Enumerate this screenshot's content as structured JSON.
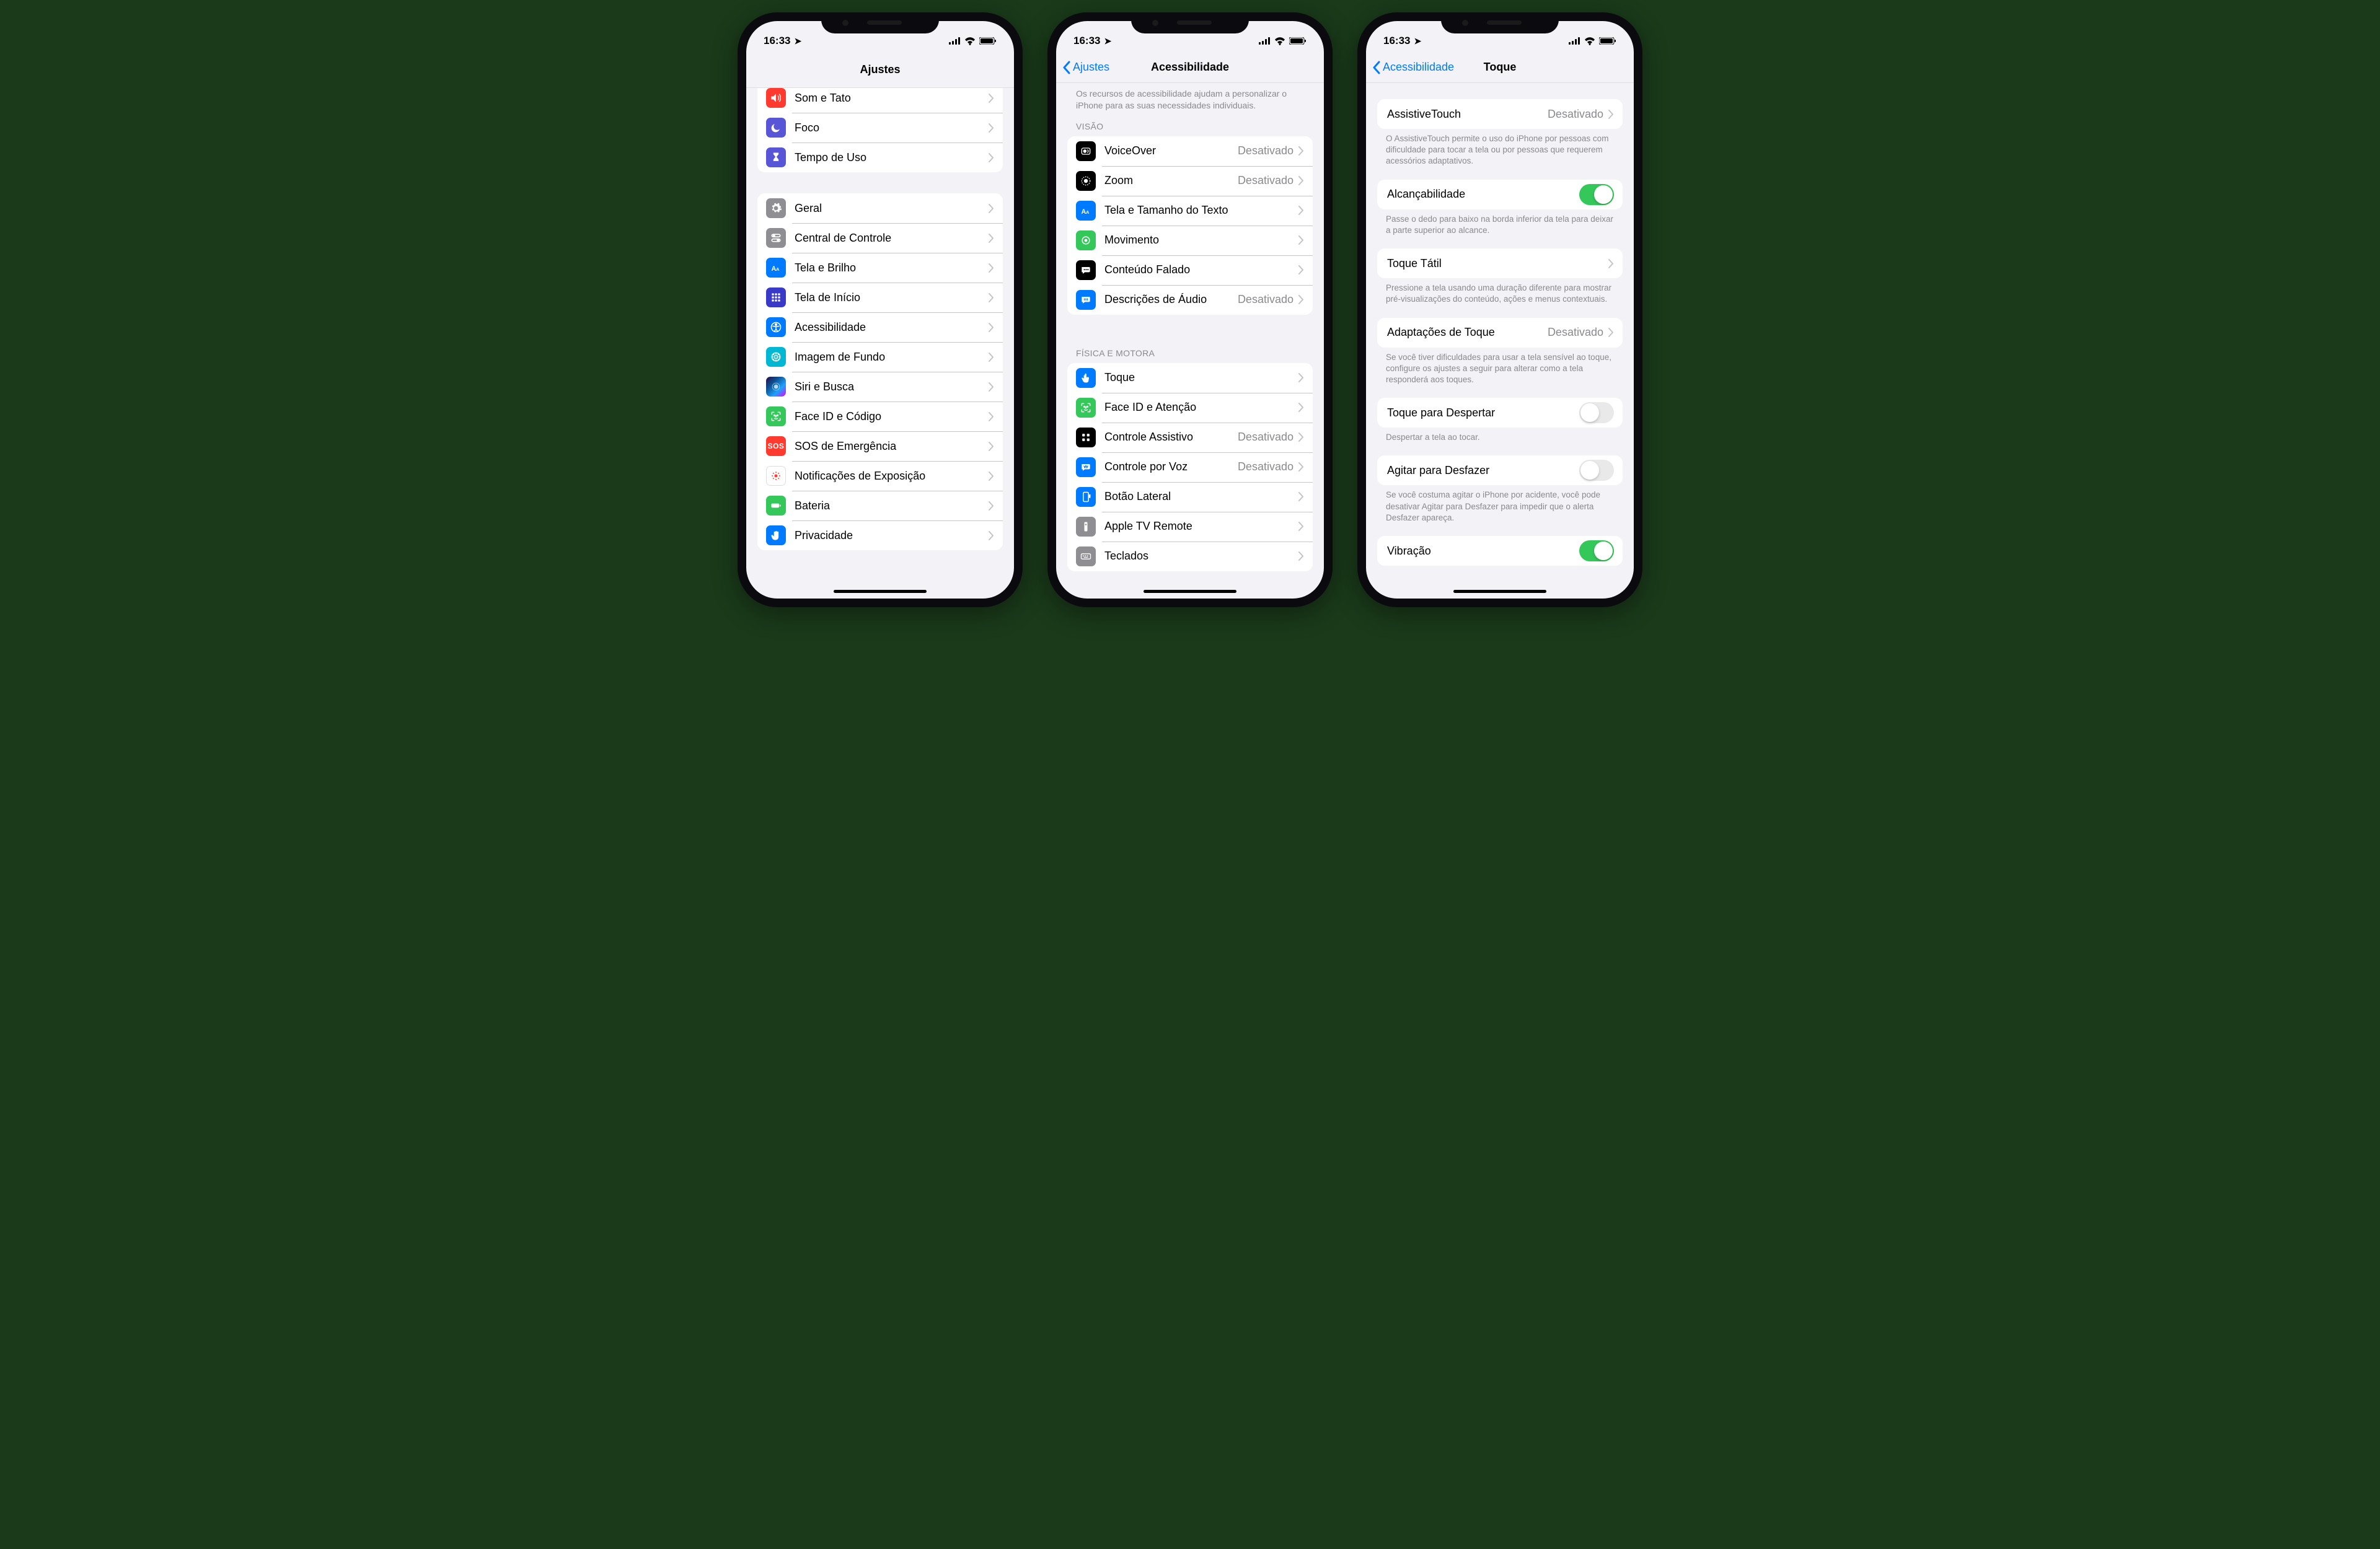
{
  "status": {
    "time": "16:33"
  },
  "phone1": {
    "title": "Ajustes",
    "group1": [
      {
        "label": "Som e Tato"
      },
      {
        "label": "Foco"
      },
      {
        "label": "Tempo de Uso"
      }
    ],
    "group2": [
      {
        "label": "Geral"
      },
      {
        "label": "Central de Controle"
      },
      {
        "label": "Tela e Brilho"
      },
      {
        "label": "Tela de Início"
      },
      {
        "label": "Acessibilidade"
      },
      {
        "label": "Imagem de Fundo"
      },
      {
        "label": "Siri e Busca"
      },
      {
        "label": "Face ID e Código"
      },
      {
        "label": "SOS de Emergência"
      },
      {
        "label": "Notificações de Exposição"
      },
      {
        "label": "Bateria"
      },
      {
        "label": "Privacidade"
      }
    ]
  },
  "phone2": {
    "back": "Ajustes",
    "title": "Acessibilidade",
    "intro": "Os recursos de acessibilidade ajudam a personalizar o iPhone para as suas necessidades individuais.",
    "sect1": "VISÃO",
    "vision": [
      {
        "label": "VoiceOver",
        "value": "Desativado"
      },
      {
        "label": "Zoom",
        "value": "Desativado"
      },
      {
        "label": "Tela e Tamanho do Texto"
      },
      {
        "label": "Movimento"
      },
      {
        "label": "Conteúdo Falado"
      },
      {
        "label": "Descrições de Áudio",
        "value": "Desativado"
      }
    ],
    "sect2": "FÍSICA E MOTORA",
    "motor": [
      {
        "label": "Toque"
      },
      {
        "label": "Face ID e Atenção"
      },
      {
        "label": "Controle Assistivo",
        "value": "Desativado"
      },
      {
        "label": "Controle por Voz",
        "value": "Desativado"
      },
      {
        "label": "Botão Lateral"
      },
      {
        "label": "Apple TV Remote"
      },
      {
        "label": "Teclados"
      }
    ]
  },
  "phone3": {
    "back": "Acessibilidade",
    "title": "Toque",
    "rows": {
      "assistive": {
        "label": "AssistiveTouch",
        "value": "Desativado"
      },
      "assistive_foot": "O AssistiveTouch permite o uso do iPhone por pessoas com dificuldade para tocar a tela ou por pessoas que requerem acessórios adaptativos.",
      "reach": {
        "label": "Alcançabilidade"
      },
      "reach_foot": "Passe o dedo para baixo na borda inferior da tela para deixar a parte superior ao alcance.",
      "haptic": {
        "label": "Toque Tátil"
      },
      "haptic_foot": "Pressione a tela usando uma duração diferente para mostrar pré-visualizações do conteúdo, ações e menus contextuais.",
      "accom": {
        "label": "Adaptações de Toque",
        "value": "Desativado"
      },
      "accom_foot": "Se você tiver dificuldades para usar a tela sensível ao toque, configure os ajustes a seguir para alterar como a tela responderá aos toques.",
      "tapwake": {
        "label": "Toque para Despertar"
      },
      "tapwake_foot": "Despertar a tela ao tocar.",
      "shake": {
        "label": "Agitar para Desfazer"
      },
      "shake_foot": "Se você costuma agitar o iPhone por acidente, você pode desativar Agitar para Desfazer para impedir que o alerta Desfazer apareça.",
      "vibration": {
        "label": "Vibração"
      }
    }
  }
}
